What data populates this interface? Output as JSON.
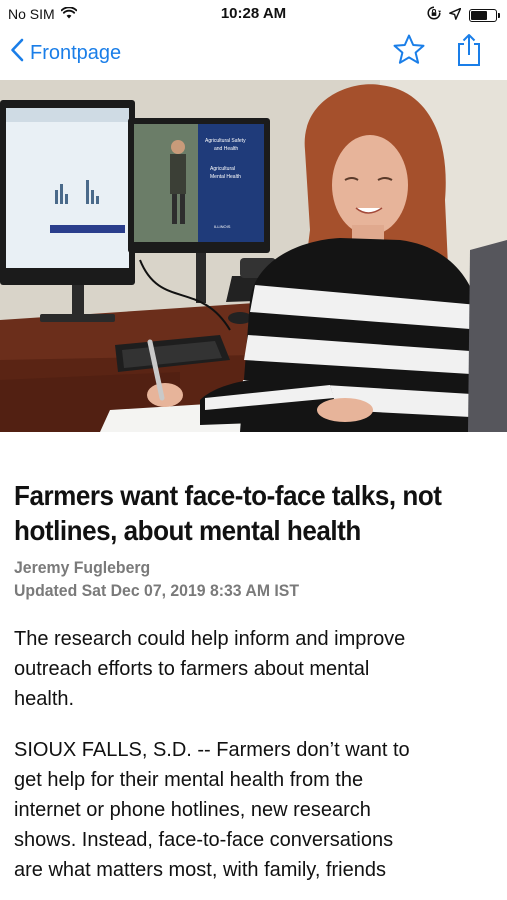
{
  "status_bar": {
    "carrier": "No SIM",
    "time": "10:28 AM",
    "battery_level": 0.7,
    "icons": [
      "wifi-icon",
      "orientation-lock-icon",
      "location-icon",
      "battery-icon"
    ]
  },
  "nav": {
    "back_label": "Frontpage",
    "accent_color": "#1a7ee8",
    "icons": [
      "chevron-left-icon",
      "star-icon",
      "share-icon"
    ]
  },
  "hero_image": {
    "monitor_right_text": [
      "Agricultural Safety",
      "and Health",
      "Agricultural",
      "Mental Health",
      "ILLINOIS"
    ]
  },
  "article": {
    "headline_line1": "Farmers want face-to-face talks, not",
    "headline_line2": "hotlines, about mental health",
    "author": "Jeremy Fugleberg",
    "updated": "Updated Sat Dec 07, 2019 8:33 AM IST",
    "para1_lines": [
      "The research could help inform and improve",
      "outreach efforts to farmers about mental",
      "health."
    ],
    "para2_lines": [
      "SIOUX FALLS, S.D. -- Farmers don’t want to",
      "get help for their mental health from the",
      "internet or phone hotlines, new research",
      "shows. Instead, face-to-face conversations",
      "are what matters most, with family, friends"
    ]
  }
}
